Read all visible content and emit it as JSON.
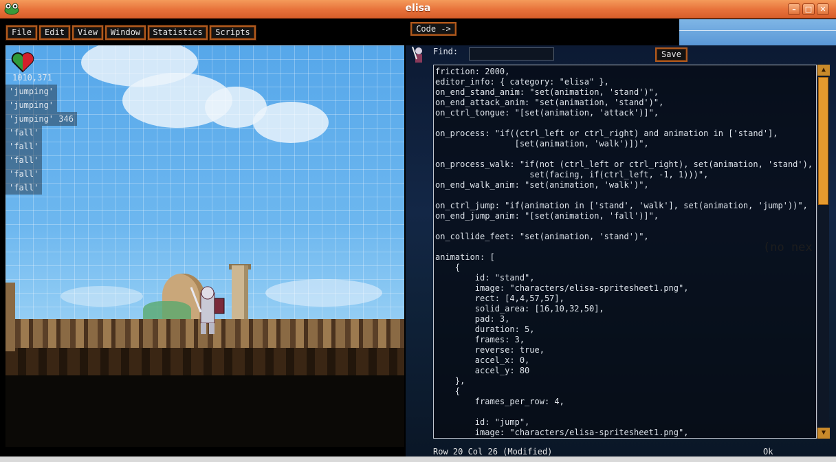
{
  "window": {
    "title": "elisa",
    "controls": {
      "minimize": "–",
      "maximize": "□",
      "close": "✕"
    }
  },
  "menu": {
    "items": [
      {
        "label": "File"
      },
      {
        "label": "Edit"
      },
      {
        "label": "View"
      },
      {
        "label": "Window"
      },
      {
        "label": "Statistics"
      },
      {
        "label": "Scripts"
      }
    ],
    "code_button": "Code ->"
  },
  "game": {
    "coords": "1010,371",
    "debug_lines": [
      "'jumping'",
      "'jumping'",
      "'jumping' 346",
      "'fall'",
      "'fall'",
      "'fall'",
      "'fall'",
      "'fall'"
    ]
  },
  "editor": {
    "find_label": "Find:",
    "find_value": "",
    "save_label": "Save",
    "lines": [
      "friction: 2000,",
      "editor_info: { category: \"elisa\" },",
      "on_end_stand_anim: \"set(animation, 'stand')\",",
      "on_end_attack_anim: \"set(animation, 'stand')\",",
      "on_ctrl_tongue: \"[set(animation, 'attack')]\",",
      "",
      "on_process: \"if((ctrl_left or ctrl_right) and animation in ['stand'],",
      "                [set(animation, 'walk')])\",",
      "",
      "on_process_walk: \"if(not (ctrl_left or ctrl_right), set(animation, 'stand'),",
      "                   set(facing, if(ctrl_left, -1, 1)))\",",
      "on_end_walk_anim: \"set(animation, 'walk')\",",
      "",
      "on_ctrl_jump: \"if(animation in ['stand', 'walk'], set(animation, 'jump'))\",",
      "on_end_jump_anim: \"[set(animation, 'fall')]\",",
      "",
      "on_collide_feet: \"set(animation, 'stand')\",",
      "",
      "animation: [",
      "    {",
      "        id: \"stand\",",
      "        image: \"characters/elisa-spritesheet1.png\",",
      "        rect: [4,4,57,57],",
      "        solid_area: [16,10,32,50],",
      "        pad: 3,",
      "        duration: 5,",
      "        frames: 3,",
      "        reverse: true,",
      "        accel_x: 0,",
      "        accel_y: 80",
      "    },",
      "    {",
      "        frames_per_row: 4,",
      "",
      "        id: \"jump\",",
      "        image: \"characters/elisa-spritesheet1.png\","
    ],
    "no_next_text": "(no nex",
    "status": "Row 20 Col 26 (Modified)",
    "status_ok": "Ok",
    "scroll_up": "▲",
    "scroll_down": "▼"
  },
  "colors": {
    "accent": "#e7713a",
    "button_border": "#b05a1e",
    "scroll_thumb": "#e59a2e"
  }
}
